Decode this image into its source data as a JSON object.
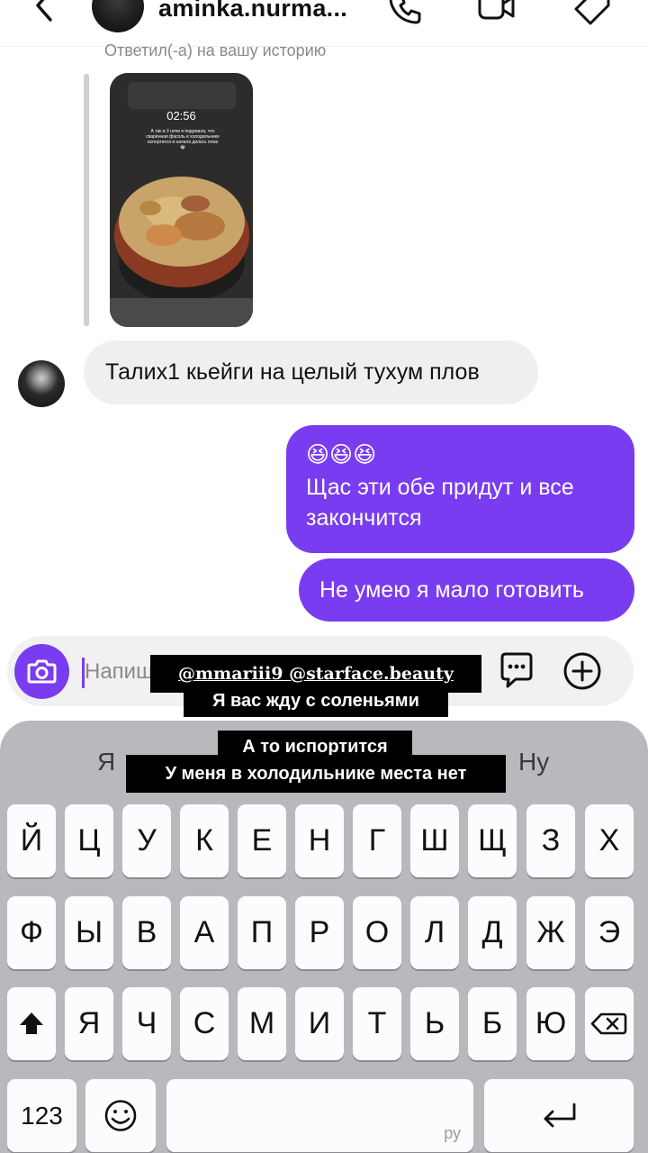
{
  "header": {
    "username": "aminka.nurma...",
    "icons": [
      "chevron-left-icon",
      "phone-icon",
      "video-icon",
      "tag-icon"
    ]
  },
  "story_reply": {
    "caption": "Ответил(-а) на вашу историю",
    "story_time": "02:56",
    "story_caption": "А так в 3 ночи я подумала, что сварённая фасоль в холодильнике испортится и начала делать плов 😂"
  },
  "messages": [
    {
      "direction": "incoming",
      "text": "Талих1 кьейги на целый тухум плов"
    },
    {
      "direction": "outgoing",
      "emoji": "😆😆😆",
      "text": "Щас эти обе придут и все закончится"
    },
    {
      "direction": "outgoing",
      "text": "Не умею я мало готовить"
    }
  ],
  "composer": {
    "placeholder": "Напишите сообщение...",
    "icons": [
      "camera-icon",
      "sticker-icon",
      "plus-circle-icon"
    ]
  },
  "overlay": {
    "mentions": "@mmariii9 @starface.beauty",
    "line2": "Я вас жду с соленьями",
    "line3": "А то испортится",
    "line4": "У меня в холодильнике места нет"
  },
  "keyboard": {
    "suggestions": [
      "Я",
      "Ну"
    ],
    "row1": [
      "Й",
      "Ц",
      "У",
      "К",
      "Е",
      "Н",
      "Г",
      "Ш",
      "Щ",
      "З",
      "Х"
    ],
    "row2": [
      "Ф",
      "Ы",
      "В",
      "А",
      "П",
      "Р",
      "О",
      "Л",
      "Д",
      "Ж",
      "Э"
    ],
    "row3": [
      "Я",
      "Ч",
      "С",
      "М",
      "И",
      "Т",
      "Ь",
      "Б",
      "Ю"
    ],
    "numbers_label": "123",
    "space_language": "ру",
    "icons": [
      "shift-icon",
      "backspace-icon",
      "emoji-icon",
      "return-icon"
    ]
  },
  "colors": {
    "accent": "#7a3cf0",
    "incoming_bubble": "#efefef",
    "keyboard_bg": "#b8b9bd"
  }
}
